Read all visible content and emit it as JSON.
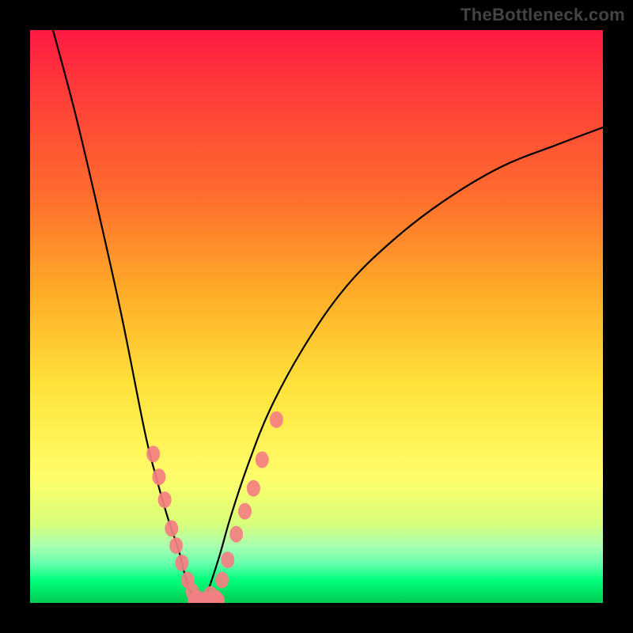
{
  "attribution": "TheBottleneck.com",
  "chart_data": {
    "type": "line",
    "title": "",
    "xlabel": "",
    "ylabel": "",
    "xlim": [
      0,
      100
    ],
    "ylim": [
      0,
      100
    ],
    "series": [
      {
        "name": "left-curve",
        "x": [
          4,
          8,
          12,
          16,
          20,
          22,
          24,
          26,
          27,
          28,
          29,
          30
        ],
        "y": [
          100,
          85,
          68,
          50,
          30,
          22,
          15,
          9,
          5,
          2,
          0.5,
          0
        ]
      },
      {
        "name": "right-curve",
        "x": [
          30,
          31,
          33,
          35,
          38,
          42,
          48,
          55,
          63,
          72,
          82,
          92,
          100
        ],
        "y": [
          0,
          2,
          8,
          15,
          24,
          34,
          45,
          55,
          63,
          70,
          76,
          80,
          83
        ]
      }
    ],
    "markers": {
      "name": "hotspot-markers",
      "color": "#f47f82",
      "points": [
        {
          "x": 21.5,
          "y": 26
        },
        {
          "x": 22.5,
          "y": 22
        },
        {
          "x": 23.5,
          "y": 18
        },
        {
          "x": 24.7,
          "y": 13
        },
        {
          "x": 25.5,
          "y": 10
        },
        {
          "x": 26.5,
          "y": 7
        },
        {
          "x": 27.5,
          "y": 4
        },
        {
          "x": 28.3,
          "y": 2
        },
        {
          "x": 29.2,
          "y": 0.8
        },
        {
          "x": 30.5,
          "y": 0.5
        },
        {
          "x": 31.5,
          "y": 1.5
        },
        {
          "x": 32.5,
          "y": 0.8
        },
        {
          "x": 33.5,
          "y": 4
        },
        {
          "x": 34.5,
          "y": 7.5
        },
        {
          "x": 36,
          "y": 12
        },
        {
          "x": 37.5,
          "y": 16
        },
        {
          "x": 39,
          "y": 20
        },
        {
          "x": 40.5,
          "y": 25
        },
        {
          "x": 43,
          "y": 32
        }
      ]
    },
    "bottom_band": {
      "name": "bottom-marker-band",
      "color": "#f47f82",
      "x_start": 27.5,
      "x_end": 34,
      "y": 0.5
    },
    "gradient_stops": [
      {
        "pos": 0,
        "color": "#ff1a42"
      },
      {
        "pos": 28,
        "color": "#ff6a2e"
      },
      {
        "pos": 62,
        "color": "#ffe23a"
      },
      {
        "pos": 90,
        "color": "#aaffb0"
      },
      {
        "pos": 100,
        "color": "#00c94f"
      }
    ]
  }
}
